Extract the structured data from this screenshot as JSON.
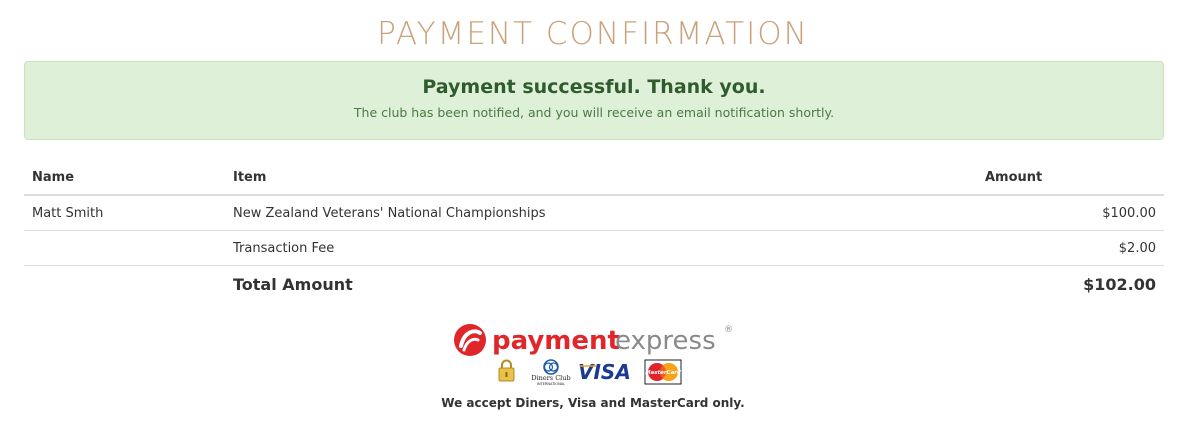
{
  "page": {
    "title": "PAYMENT CONFIRMATION"
  },
  "alert": {
    "heading": "Payment successful. Thank you.",
    "message": "The club has been notified, and you will receive an email notification shortly."
  },
  "table": {
    "headers": {
      "name": "Name",
      "item": "Item",
      "amount": "Amount"
    },
    "rows": [
      {
        "name": "Matt Smith",
        "item": "New Zealand Veterans' National Championships",
        "amount": "$100.00"
      },
      {
        "name": "",
        "item": "Transaction Fee",
        "amount": "$2.00"
      }
    ],
    "total_label": "Total Amount",
    "total_value": "$102.00"
  },
  "footer": {
    "brand_primary": "payment",
    "brand_secondary": "express",
    "brand_mark": "®",
    "cards": [
      "lock-icon",
      "diners-club-icon",
      "visa-icon",
      "mastercard-icon"
    ],
    "diners_text_1": "Diners Club",
    "diners_text_2": "INTERNATIONAL",
    "visa_text": "VISA",
    "mastercard_text": "MasterCard",
    "accept_text": "We accept Diners, Visa and MasterCard only."
  },
  "colors": {
    "title": "#c9a27a",
    "alert_bg": "#dff0d8",
    "success_text": "#2e5c2e",
    "total_text": "#3b7a3b",
    "brand_red": "#e0262b",
    "brand_grey": "#8a8a8a"
  }
}
